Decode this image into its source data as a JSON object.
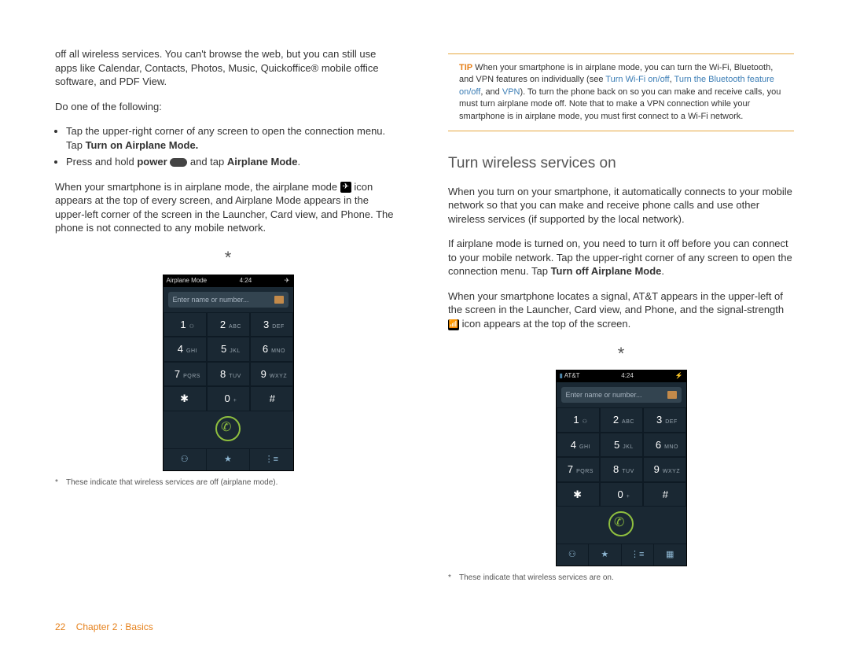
{
  "left": {
    "intro": "off all wireless services. You can't browse the web, but you can still use apps like Calendar, Contacts, Photos, Music, Quickoffice® mobile office software, and PDF View.",
    "do_one": "Do one of the following:",
    "bullet1a": "Tap the upper-right corner of any screen to open the connection menu. Tap ",
    "bullet1b": "Turn on Airplane Mode.",
    "bullet2a": "Press and hold ",
    "bullet2b": "power",
    "bullet2c": " and tap ",
    "bullet2d": "Airplane Mode",
    "bullet2e": ".",
    "para2a": "When your smartphone is in airplane mode, the airplane mode ",
    "para2b": " icon appears at the top of every screen, and Airplane Mode appears in the upper-left corner of the screen in the Launcher, Card view, and Phone. The phone is not connected to any mobile network.",
    "phone": {
      "status_left": "Airplane Mode",
      "status_time": "4:24",
      "search_placeholder": "Enter name or number..."
    },
    "caption": "These indicate that wireless services are off (airplane mode)."
  },
  "right": {
    "tip_label": "TIP",
    "tip_a": " When your smartphone is in airplane mode, you can turn the Wi-Fi, Bluetooth, and VPN features on individually (see ",
    "tip_link1": "Turn Wi-Fi on/off",
    "tip_sep1": ", ",
    "tip_link2": "Turn the Bluetooth feature on/off",
    "tip_sep2": ", and ",
    "tip_link3": "VPN",
    "tip_b": "). To turn the phone back on so you can make and receive calls, you must turn airplane mode off. Note that to make a VPN connection while your smartphone is in airplane mode, you must first connect to a Wi-Fi network.",
    "heading": "Turn wireless services on",
    "p1": "When you turn on your smartphone, it automatically connects to your mobile network so that you can make and receive phone calls and use other wireless services (if supported by the local network).",
    "p2a": "If airplane mode is turned on, you need to turn it off before you can connect to your mobile network. Tap the upper-right corner of any screen to open the connection menu. Tap ",
    "p2b": "Turn off Airplane Mode",
    "p2c": ".",
    "p3a": "When your smartphone locates a signal, AT&T appears in the upper-left of the screen in the Launcher, Card view, and Phone, and the signal-strength ",
    "p3b": " icon appears at the top of the screen.",
    "phone": {
      "status_left": "AT&T",
      "status_time": "4:24",
      "search_placeholder": "Enter name or number..."
    },
    "caption": "These indicate that wireless services are on."
  },
  "keypad": [
    {
      "n": "1",
      "l": "⚇"
    },
    {
      "n": "2",
      "l": "ABC"
    },
    {
      "n": "3",
      "l": "DEF"
    },
    {
      "n": "4",
      "l": "GHI"
    },
    {
      "n": "5",
      "l": "JKL"
    },
    {
      "n": "6",
      "l": "MNO"
    },
    {
      "n": "7",
      "l": "PQRS"
    },
    {
      "n": "8",
      "l": "TUV"
    },
    {
      "n": "9",
      "l": "WXYZ"
    },
    {
      "n": "✱",
      "l": ""
    },
    {
      "n": "0",
      "l": "+"
    },
    {
      "n": "#",
      "l": ""
    }
  ],
  "bottom_icons": [
    "⚇",
    "★",
    "⋮≡"
  ],
  "bottom_icons2": [
    "⚇",
    "★",
    "⋮≡",
    "▦"
  ],
  "footer": {
    "page": "22",
    "chapter": "Chapter 2 : Basics"
  }
}
